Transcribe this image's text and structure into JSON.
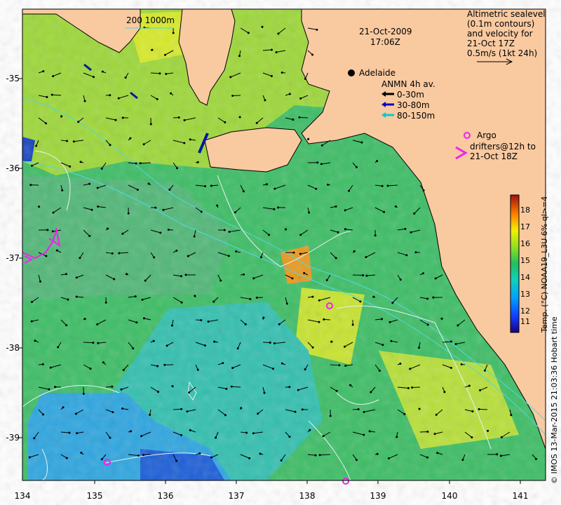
{
  "map": {
    "datetime_date": "21-Oct-2009",
    "datetime_time": "17:06Z",
    "city": "Adelaide",
    "bathy_legend": "200  1000m",
    "altimetry": [
      "Altimetric sealevel",
      "(0.1m contours)",
      "and velocity for",
      "21-Oct 17Z",
      "0.5m/s (1kt 24h)"
    ],
    "anmn_title": "ANMN 4h av.",
    "anmn_ranges": [
      "0-30m",
      "30-80m",
      "80-150m"
    ],
    "anmn_colors": [
      "#000000",
      "#0000cc",
      "#00cccc"
    ],
    "argo_label": "Argo",
    "drifters": [
      "drifters@12h to",
      "21-Oct 18Z"
    ],
    "argo_color": "#ee22ee",
    "land_color": "#f9c9a0",
    "colorbar_title": "Temp. (°C) NOAA19_L3U 6% ql>=4",
    "colorbar_ticks": [
      "18",
      "17",
      "16",
      "15",
      "14",
      "13",
      "12",
      "11"
    ],
    "colorbar_range": [
      10.5,
      18.7
    ],
    "credit": "© IMOS 13-Mar-2015 21:03:36 Hobart time",
    "x_ticks": [
      "134",
      "135",
      "136",
      "137",
      "138",
      "139",
      "140",
      "141"
    ],
    "y_ticks": [
      "-35",
      "-36",
      "-37",
      "-38",
      "-39"
    ],
    "lon_range": [
      134,
      141.3
    ],
    "lat_range": [
      -39.5,
      -34.2
    ]
  }
}
